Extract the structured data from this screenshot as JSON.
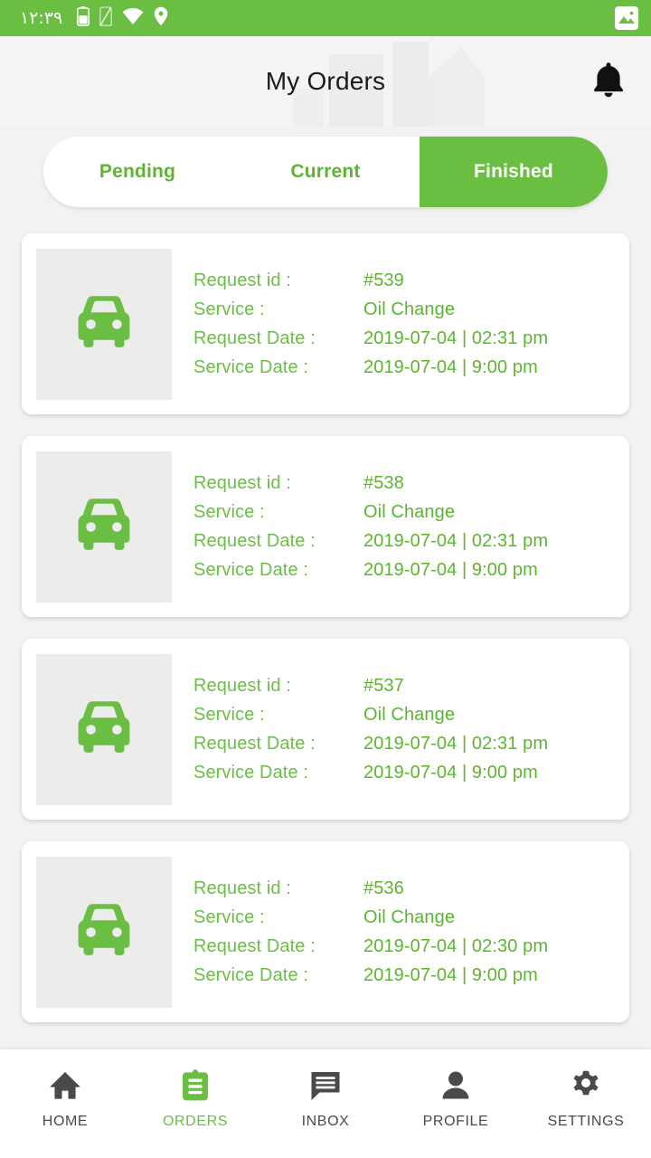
{
  "theme": {
    "green": "#6abf43",
    "green_text": "#5cb531",
    "page_bg": "#f2f2f2",
    "card_bg": "#ffffff",
    "thumb_bg": "#ececec",
    "dark_text": "#1b1b1b",
    "nav_text": "#4a4a4a"
  },
  "status_bar": {
    "time": "١٢:٣٩",
    "icons": [
      "battery-icon",
      "sim-card-off-icon",
      "wifi-icon",
      "location-pin-icon"
    ],
    "right_icon": "screenshot-image-icon"
  },
  "header": {
    "title": "My Orders",
    "notification_icon": "bell-icon"
  },
  "tabs": {
    "items": [
      {
        "label": "Pending",
        "active": false
      },
      {
        "label": "Current",
        "active": false
      },
      {
        "label": "Finished",
        "active": true
      }
    ]
  },
  "orders": {
    "labels": {
      "request_id": "Request id :",
      "service": "Service :",
      "request_date": "Request Date :",
      "service_date": "Service Date :"
    },
    "thumbnail_icon": "car-front-icon",
    "items": [
      {
        "request_id": "#539",
        "service": "Oil Change",
        "request_date": "2019-07-04 | 02:31 pm",
        "service_date": "2019-07-04 | 9:00 pm"
      },
      {
        "request_id": "#538",
        "service": "Oil Change",
        "request_date": "2019-07-04 | 02:31 pm",
        "service_date": "2019-07-04 | 9:00 pm"
      },
      {
        "request_id": "#537",
        "service": "Oil Change",
        "request_date": "2019-07-04 | 02:31 pm",
        "service_date": "2019-07-04 | 9:00 pm"
      },
      {
        "request_id": "#536",
        "service": "Oil Change",
        "request_date": "2019-07-04 | 02:30 pm",
        "service_date": "2019-07-04 | 9:00 pm"
      }
    ]
  },
  "bottom_nav": {
    "items": [
      {
        "label": "HOME",
        "icon": "home-icon",
        "active": false
      },
      {
        "label": "ORDERS",
        "icon": "clipboard-icon",
        "active": true
      },
      {
        "label": "INBOX",
        "icon": "chat-bubble-icon",
        "active": false
      },
      {
        "label": "PROFILE",
        "icon": "person-icon",
        "active": false
      },
      {
        "label": "SETTINGS",
        "icon": "gear-icon",
        "active": false
      }
    ]
  }
}
